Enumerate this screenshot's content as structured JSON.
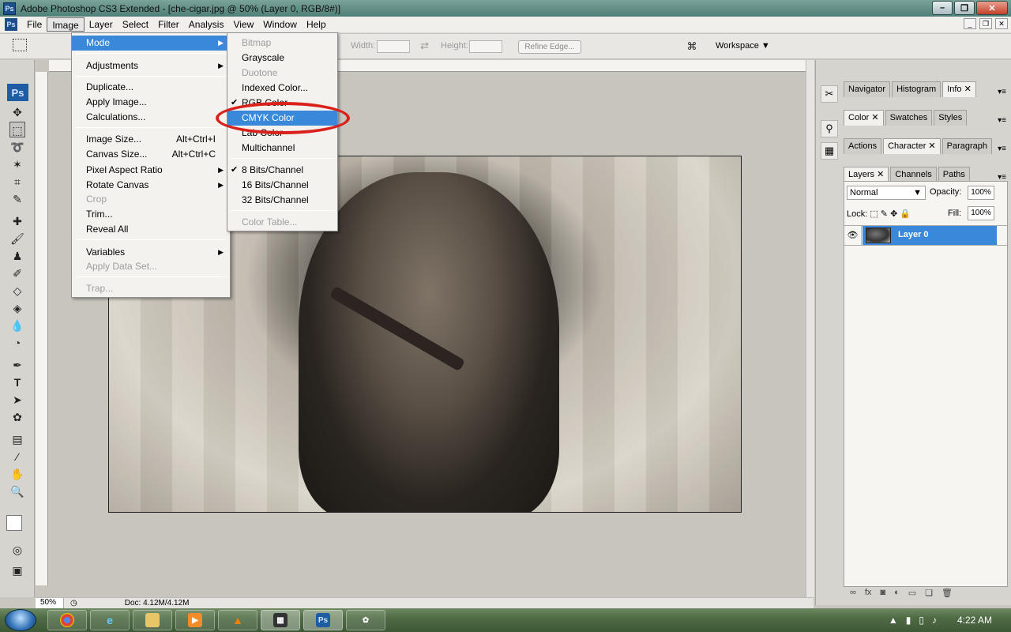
{
  "window": {
    "title": "Adobe Photoshop CS3 Extended - [che-cigar.jpg @ 50% (Layer 0, RGB/8#)]",
    "app_icon": "Ps"
  },
  "menubar": {
    "items": [
      "File",
      "Image",
      "Layer",
      "Select",
      "Filter",
      "Analysis",
      "View",
      "Window",
      "Help"
    ],
    "active": "Image"
  },
  "options": {
    "width_label": "Width:",
    "height_label": "Height:",
    "refine_edge": "Refine Edge...",
    "workspace": "Workspace"
  },
  "image_menu": {
    "items": [
      {
        "label": "Mode",
        "submenu": true,
        "highlight": true
      },
      {
        "label": "Adjustments",
        "submenu": true
      },
      {
        "label": "Duplicate..."
      },
      {
        "label": "Apply Image..."
      },
      {
        "label": "Calculations..."
      },
      {
        "label": "Image Size...",
        "shortcut": "Alt+Ctrl+I"
      },
      {
        "label": "Canvas Size...",
        "shortcut": "Alt+Ctrl+C"
      },
      {
        "label": "Pixel Aspect Ratio",
        "submenu": true
      },
      {
        "label": "Rotate Canvas",
        "submenu": true
      },
      {
        "label": "Crop",
        "disabled": true
      },
      {
        "label": "Trim..."
      },
      {
        "label": "Reveal All"
      },
      {
        "label": "Variables",
        "submenu": true
      },
      {
        "label": "Apply Data Set...",
        "disabled": true
      },
      {
        "label": "Trap...",
        "disabled": true
      }
    ]
  },
  "mode_menu": {
    "items": [
      {
        "label": "Bitmap",
        "disabled": true
      },
      {
        "label": "Grayscale"
      },
      {
        "label": "Duotone",
        "disabled": true
      },
      {
        "label": "Indexed Color..."
      },
      {
        "label": "RGB Color",
        "checked": true
      },
      {
        "label": "CMYK Color",
        "highlight": true
      },
      {
        "label": "Lab Color"
      },
      {
        "label": "Multichannel"
      },
      {
        "label": "8 Bits/Channel",
        "checked": true
      },
      {
        "label": "16 Bits/Channel"
      },
      {
        "label": "32 Bits/Channel"
      },
      {
        "label": "Color Table...",
        "disabled": true
      }
    ]
  },
  "panels": {
    "group1": [
      "Navigator",
      "Histogram",
      "Info"
    ],
    "group2": [
      "Color",
      "Swatches",
      "Styles"
    ],
    "group3": [
      "Actions",
      "Character",
      "Paragraph"
    ],
    "group4": [
      "Layers",
      "Channels",
      "Paths"
    ],
    "blend_mode": "Normal",
    "opacity_label": "Opacity:",
    "opacity": "100%",
    "lock_label": "Lock:",
    "fill_label": "Fill:",
    "fill": "100%",
    "layer_name": "Layer 0"
  },
  "status": {
    "zoom": "50%",
    "doc": "Doc: 4.12M/4.12M"
  },
  "taskbar": {
    "clock": "4:22 AM",
    "ps_label": "Ps"
  },
  "colors": {
    "highlight": "#3a88d9",
    "annotation": "#d9201b"
  }
}
